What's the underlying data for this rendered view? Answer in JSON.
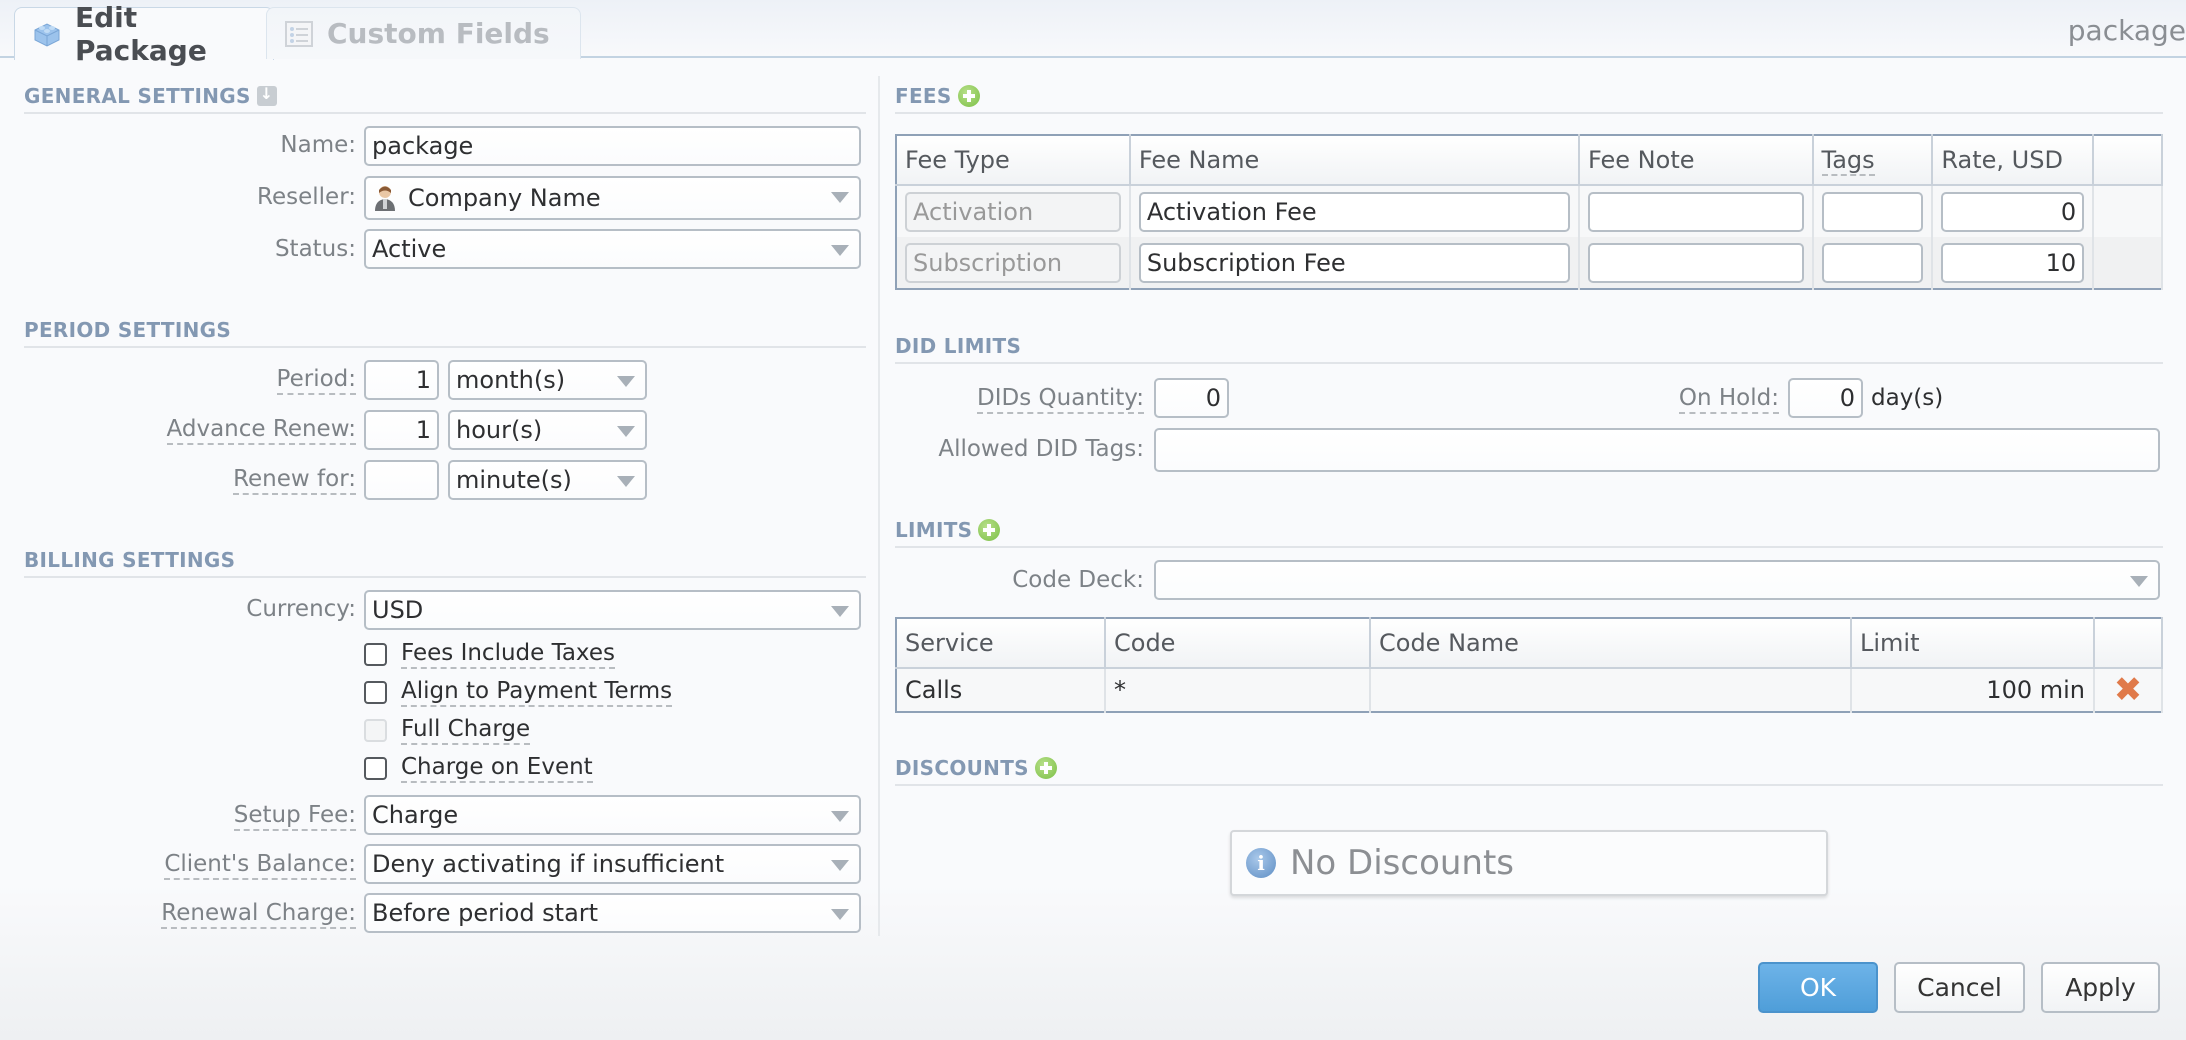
{
  "tabs": [
    {
      "label": "Edit Package",
      "icon": "lego-block-icon",
      "active": true
    },
    {
      "label": "Custom Fields",
      "icon": "list-icon",
      "active": false
    }
  ],
  "window_title": "package",
  "general": {
    "title": "GENERAL SETTINGS",
    "name_label": "Name:",
    "name_value": "package",
    "reseller_label": "Reseller:",
    "reseller_value": "Company Name",
    "status_label": "Status:",
    "status_value": "Active"
  },
  "period": {
    "title": "PERIOD SETTINGS",
    "period_label": "Period:",
    "period_value": "1",
    "period_unit": "month(s)",
    "advance_label": "Advance Renew:",
    "advance_value": "1",
    "advance_unit": "hour(s)",
    "renew_label": "Renew for:",
    "renew_value": "",
    "renew_unit": "minute(s)"
  },
  "billing": {
    "title": "BILLING SETTINGS",
    "currency_label": "Currency:",
    "currency_value": "USD",
    "checkboxes": [
      {
        "label": "Fees Include Taxes",
        "checked": false,
        "disabled": false
      },
      {
        "label": "Align to Payment Terms",
        "checked": false,
        "disabled": false
      },
      {
        "label": "Full Charge",
        "checked": false,
        "disabled": true
      },
      {
        "label": "Charge on Event",
        "checked": false,
        "disabled": false
      }
    ],
    "setup_fee_label": "Setup Fee:",
    "setup_fee_value": "Charge",
    "balance_label": "Client's Balance:",
    "balance_value": "Deny activating if insufficient",
    "renewal_label": "Renewal Charge:",
    "renewal_value": "Before period start"
  },
  "fees": {
    "title": "FEES",
    "columns": [
      "Fee Type",
      "Fee Name",
      "Fee Note",
      "Tags",
      "Rate, USD",
      ""
    ],
    "rows": [
      {
        "type": "Activation",
        "name": "Activation Fee",
        "note": "",
        "tags": "",
        "rate": "0"
      },
      {
        "type": "Subscription",
        "name": "Subscription Fee",
        "note": "",
        "tags": "",
        "rate": "10"
      }
    ]
  },
  "did_limits": {
    "title": "DID LIMITS",
    "qty_label": "DIDs Quantity:",
    "qty_value": "0",
    "onhold_label": "On Hold:",
    "onhold_value": "0",
    "onhold_unit": "day(s)",
    "tags_label": "Allowed DID Tags:",
    "tags_value": ""
  },
  "limits": {
    "title": "LIMITS",
    "codedeck_label": "Code Deck:",
    "codedeck_value": "",
    "columns": [
      "Service",
      "Code",
      "Code Name",
      "Limit",
      ""
    ],
    "rows": [
      {
        "service": "Calls",
        "code": "*",
        "code_name": "",
        "limit": "100 min"
      }
    ]
  },
  "discounts": {
    "title": "DISCOUNTS",
    "empty_message": "No Discounts"
  },
  "buttons": {
    "ok": "OK",
    "cancel": "Cancel",
    "apply": "Apply"
  }
}
